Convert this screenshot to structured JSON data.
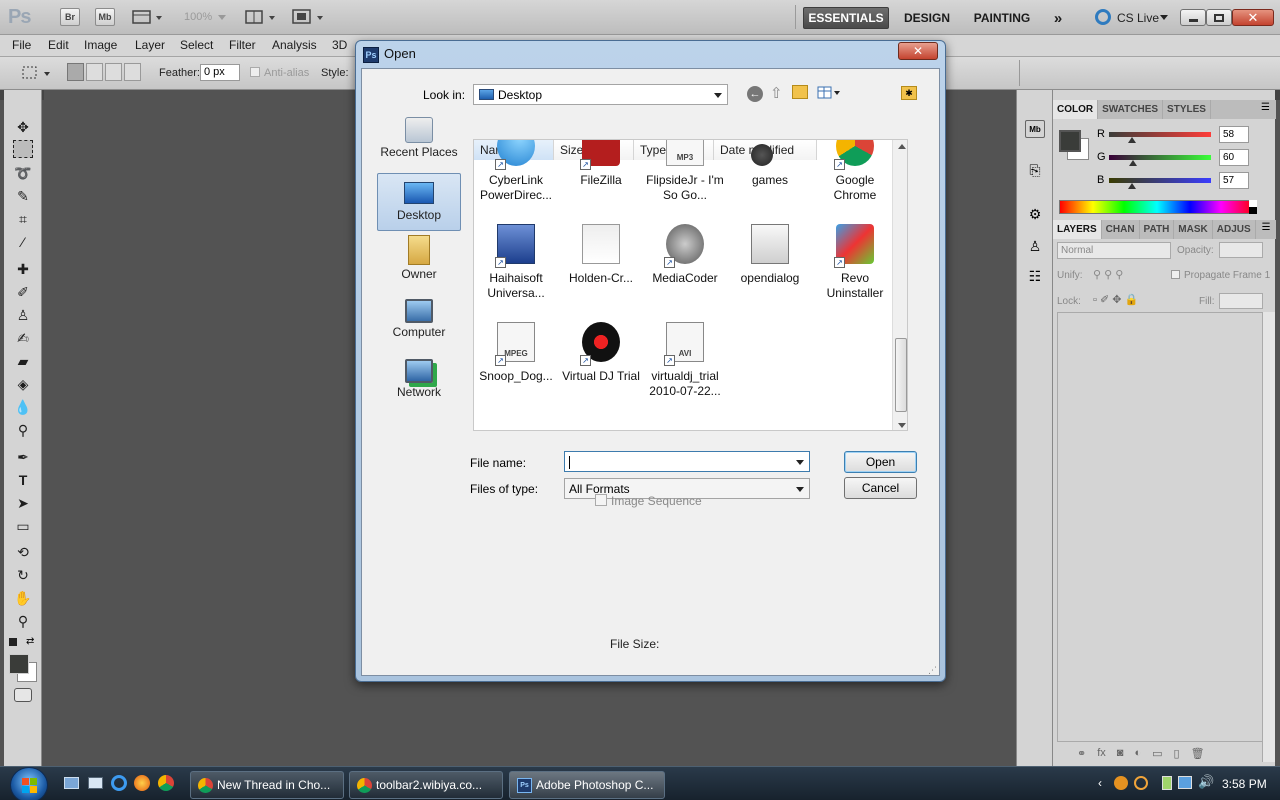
{
  "app": {
    "logo": "Ps",
    "bridge_label": "Br",
    "minibridge_label": "Mb",
    "zoom": "100%",
    "workspaces": [
      "ESSENTIALS",
      "DESIGN",
      "PAINTING"
    ],
    "more_label": "»",
    "cs_live": "CS Live"
  },
  "menu": [
    "File",
    "Edit",
    "Image",
    "Layer",
    "Select",
    "Filter",
    "Analysis",
    "3D"
  ],
  "options": {
    "feather_label": "Feather:",
    "feather_value": "0 px",
    "antialias_label": "Anti-alias",
    "style_label": "Style:"
  },
  "dialog": {
    "title": "Open",
    "look_in_label": "Look in:",
    "look_in_value": "Desktop",
    "places": [
      "Recent Places",
      "Desktop",
      "Owner",
      "Computer",
      "Network"
    ],
    "selected_place": "Desktop",
    "columns": [
      "Name",
      "Size",
      "Type",
      "Date modified"
    ],
    "files": [
      {
        "name": "CyberLink PowerDirec...",
        "icon": "cyberlink-icon"
      },
      {
        "name": "FileZilla",
        "icon": "filezilla-icon"
      },
      {
        "name": "FlipsideJr - I'm So Go...",
        "icon": "mp3-icon"
      },
      {
        "name": "games",
        "icon": "games-icon"
      },
      {
        "name": "Google Chrome",
        "icon": "chrome-icon"
      },
      {
        "name": "Haihaisoft Universa...",
        "icon": "haihaisoft-icon"
      },
      {
        "name": "Holden-Cr...",
        "icon": "car-image-icon"
      },
      {
        "name": "MediaCoder",
        "icon": "mediacoder-icon"
      },
      {
        "name": "opendialog",
        "icon": "screenshot-image-icon"
      },
      {
        "name": "Revo Uninstaller",
        "icon": "revo-icon"
      },
      {
        "name": "Snoop_Dog...",
        "icon": "mpeg-icon"
      },
      {
        "name": "Virtual DJ Trial",
        "icon": "virtualdj-icon"
      },
      {
        "name": "virtualdj_trial 2010-07-22...",
        "icon": "avi-icon"
      }
    ],
    "file_name_label": "File name:",
    "file_name_value": "",
    "files_of_type_label": "Files of type:",
    "files_of_type_value": "All Formats",
    "open_button": "Open",
    "cancel_button": "Cancel",
    "image_sequence_label": "Image Sequence",
    "file_size_label": "File Size:"
  },
  "color_panel": {
    "tabs": [
      "COLOR",
      "SWATCHES",
      "STYLES"
    ],
    "r_label": "R",
    "r_value": "58",
    "g_label": "G",
    "g_value": "60",
    "b_label": "B",
    "b_value": "57",
    "r": 58,
    "g": 60,
    "b": 57
  },
  "layers_panel": {
    "tabs": [
      "LAYERS",
      "CHAN",
      "PATH",
      "MASK",
      "ADJUS"
    ],
    "blend_mode": "Normal",
    "opacity_label": "Opacity:",
    "unify_label": "Unify:",
    "propagate_label": "Propagate Frame 1",
    "lock_label": "Lock:",
    "fill_label": "Fill:"
  },
  "taskbar": {
    "tasks": [
      "New Thread in Cho...",
      "toolbar2.wibiya.co...",
      "Adobe Photoshop C..."
    ],
    "clock": "3:58 PM"
  },
  "colors": {
    "ps_gray": "#535353",
    "dialog_frame": "#bcd3ea",
    "selection_blue": "#cfe0f4",
    "close_red": "#c4432f"
  }
}
